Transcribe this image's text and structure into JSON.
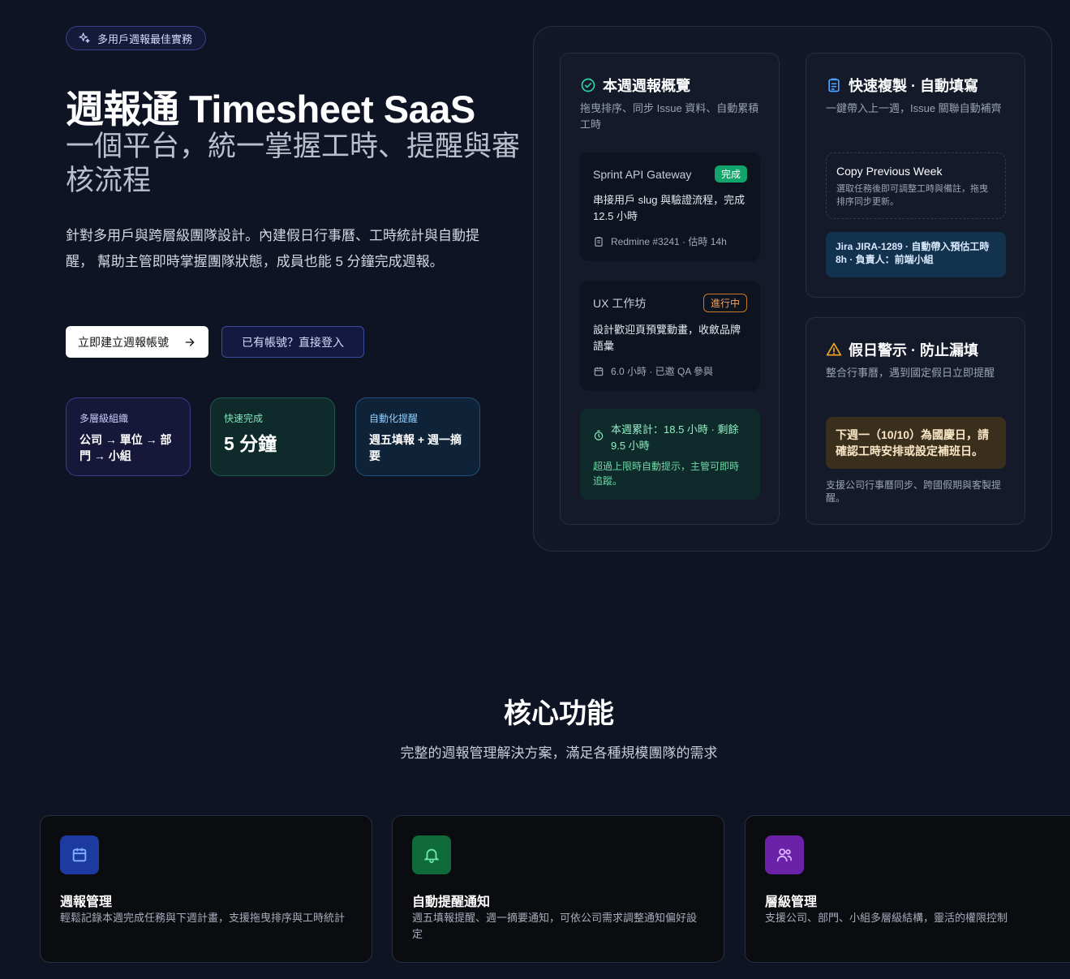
{
  "hero": {
    "badge": "多用戶週報最佳實務",
    "title": "週報通 Timesheet SaaS",
    "subtitle": "一個平台，統一掌握工時、提醒與審核流程",
    "description": "針對多用戶與跨層級團隊設計。內建假日行事曆、工時統計與自動提醒， 幫助主管即時掌握團隊狀態，成員也能 5 分鐘完成週報。",
    "primary_button": "立即建立週報帳號",
    "secondary_button": "已有帳號？直接登入",
    "stats": [
      {
        "label": "多層級組織",
        "value": "公司 → 單位 → 部門 → 小組"
      },
      {
        "label": "快速完成",
        "value": "5 分鐘"
      },
      {
        "label": "自動化提醒",
        "value": "週五填報 + 週一摘要"
      }
    ]
  },
  "overview": {
    "title": "本週週報概覽",
    "subtitle": "拖曳排序、同步 Issue 資料、自動累積工時",
    "tasks": [
      {
        "name": "Sprint API Gateway",
        "status": "完成",
        "body": "串接用戶 slug 與驗證流程，完成 12.5 小時",
        "meta": "Redmine #3241 · 估時 14h"
      },
      {
        "name": "UX 工作坊",
        "status": "進行中",
        "body": "設計歡迎頁預覽動畫，收斂品牌語彙",
        "meta": "6.0 小時 · 已邀 QA 參與"
      }
    ],
    "summary_main": "本週累計：18.5 小時 · 剩餘 9.5 小時",
    "summary_note": "超過上限時自動提示，主管可即時追蹤。"
  },
  "copy": {
    "title": "快速複製 · 自動填寫",
    "subtitle": "一鍵帶入上一週，Issue 關聯自動補齊",
    "box_title": "Copy Previous Week",
    "box_desc": "選取任務後即可調整工時與備註，拖曳排序同步更新。",
    "jira": "Jira JIRA-1289 · 自動帶入預估工時 8h · 負責人：前端小組"
  },
  "holiday": {
    "title": "假日警示 · 防止漏填",
    "subtitle": "整合行事曆，遇到國定假日立即提醒",
    "alert": "下週一（10/10）為國慶日，請確認工時安排或設定補班日。",
    "note": "支援公司行事曆同步、跨國假期與客製提醒。"
  },
  "features": {
    "title": "核心功能",
    "subtitle": "完整的週報管理解決方案，滿足各種規模團隊的需求",
    "items": [
      {
        "title": "週報管理",
        "desc": "輕鬆記錄本週完成任務與下週計畫，支援拖曳排序與工時統計"
      },
      {
        "title": "自動提醒通知",
        "desc": "週五填報提醒、週一摘要通知，可依公司需求調整通知偏好設定"
      },
      {
        "title": "層級管理",
        "desc": "支援公司、部門、小組多層級結構，靈活的權限控制"
      }
    ]
  },
  "colors": {
    "background": "#0f1424",
    "accent_green": "#12a56b",
    "accent_orange": "#f0a35a",
    "accent_blue": "#3b82f6",
    "accent_purple": "#7c3aed"
  },
  "icons": [
    "sparkle-icon",
    "arrow-right-icon",
    "check-circle-icon",
    "clipboard-icon",
    "calendar-icon",
    "timer-icon",
    "warning-icon",
    "bell-icon",
    "users-icon"
  ]
}
